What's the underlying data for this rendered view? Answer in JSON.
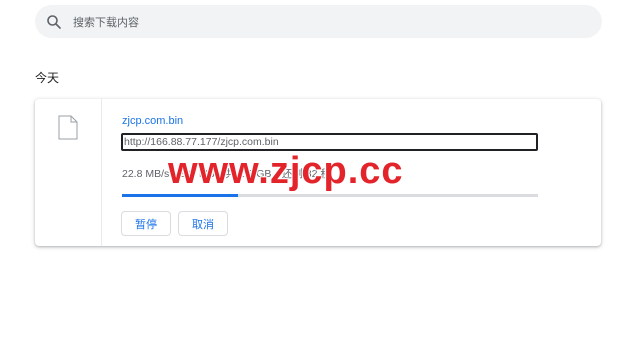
{
  "search": {
    "placeholder": "搜索下载内容",
    "icon": "search-icon"
  },
  "section": {
    "title": "今天"
  },
  "download": {
    "file_icon": "file-icon",
    "filename": "zjcp.com.bin",
    "url": "http://166.88.77.177/zjcp.com.bin",
    "status": "22.8 MB/s - 235 MB，共 1.0 GB，还剩 32 秒",
    "progress": 0.28,
    "pause_label": "暂停",
    "cancel_label": "取消"
  },
  "watermark": {
    "text": "www.zjcp.cc",
    "color": "#e3242b"
  },
  "colors": {
    "accent": "#1a73e8",
    "search_bg": "#f1f3f4",
    "progress_track": "#dadce0"
  }
}
